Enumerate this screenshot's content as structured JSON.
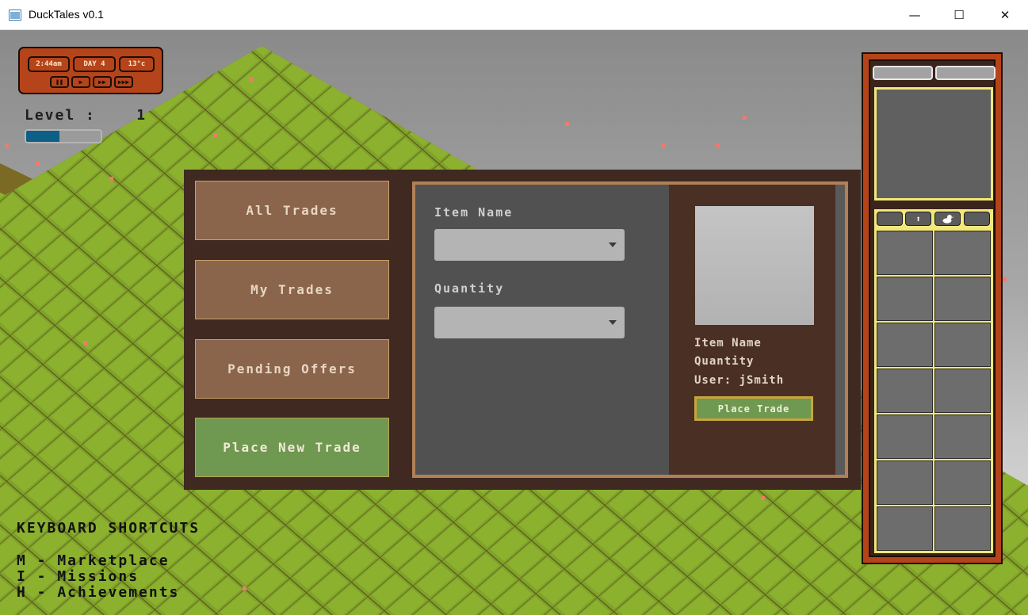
{
  "window": {
    "title": "DuckTales v0.1",
    "controls": {
      "minimize": "—",
      "maximize": "☐",
      "close": "✕"
    }
  },
  "hud": {
    "time": "2:44am",
    "day": "DAY 4",
    "temperature": "13°c",
    "controls": [
      "pause",
      "play",
      "fast-forward",
      "fastest"
    ],
    "level_label": "Level :    1",
    "xp_progress": 0.45
  },
  "market": {
    "tabs": [
      {
        "label": "All Trades",
        "active": false
      },
      {
        "label": "My Trades",
        "active": false
      },
      {
        "label": "Pending Offers",
        "active": false
      },
      {
        "label": "Place New Trade",
        "active": true
      }
    ],
    "form": {
      "item_label": "Item Name",
      "item_value": "",
      "quantity_label": "Quantity",
      "quantity_value": ""
    },
    "preview": {
      "item_name": "Item Name",
      "quantity": "Quantity",
      "user": "User: jSmith",
      "place_button": "Place Trade"
    }
  },
  "shortcuts": {
    "heading": "KEYBOARD SHORTCUTS",
    "items": [
      "M - Marketplace",
      "I - Missions",
      "H - Achievements"
    ]
  },
  "inventory": {
    "tabs": [
      "",
      "up-arrow-icon",
      "duck-icon",
      ""
    ],
    "slots": 14
  },
  "colors": {
    "accent_green": "#6f9850",
    "panel_brown": "#3f2920",
    "hud_orange": "#b6441a",
    "highlight_yellow": "#f3e77a"
  }
}
